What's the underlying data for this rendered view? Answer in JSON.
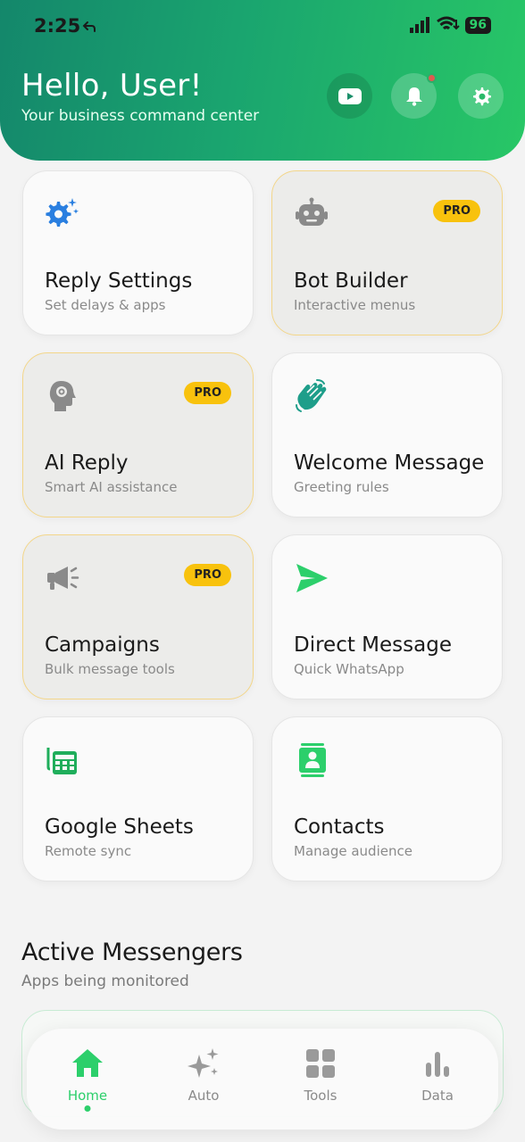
{
  "status": {
    "time": "2:25",
    "battery": "96"
  },
  "header": {
    "greeting": "Hello, User!",
    "subtitle": "Your business command center",
    "icons": [
      "youtube-icon",
      "bell-icon",
      "gear-icon"
    ]
  },
  "features": [
    {
      "title": "Reply Settings",
      "desc": "Set delays & apps",
      "pro": false,
      "icon": "gear-sparkle-icon"
    },
    {
      "title": "Bot Builder",
      "desc": "Interactive menus",
      "pro": true,
      "badge": "PRO",
      "icon": "robot-icon"
    },
    {
      "title": "AI Reply",
      "desc": "Smart AI assistance",
      "pro": true,
      "badge": "PRO",
      "icon": "brain-gear-icon"
    },
    {
      "title": "Welcome Message",
      "desc": "Greeting rules",
      "pro": false,
      "icon": "waving-hand-icon"
    },
    {
      "title": "Campaigns",
      "desc": "Bulk message tools",
      "pro": true,
      "badge": "PRO",
      "icon": "megaphone-icon"
    },
    {
      "title": "Direct Message",
      "desc": "Quick WhatsApp",
      "pro": false,
      "icon": "send-icon"
    },
    {
      "title": "Google Sheets",
      "desc": "Remote sync",
      "pro": false,
      "icon": "spreadsheet-icon"
    },
    {
      "title": "Contacts",
      "desc": "Manage audience",
      "pro": false,
      "icon": "contact-book-icon"
    }
  ],
  "active_messengers": {
    "title": "Active Messengers",
    "subtitle": "Apps being monitored"
  },
  "nav": [
    {
      "label": "Home",
      "icon": "home-icon",
      "active": true
    },
    {
      "label": "Auto",
      "icon": "sparkles-icon",
      "active": false
    },
    {
      "label": "Tools",
      "icon": "grid-icon",
      "active": false
    },
    {
      "label": "Data",
      "icon": "bar-chart-icon",
      "active": false
    }
  ],
  "colors": {
    "accent": "#2ccf6b",
    "pro_badge": "#f8c20d",
    "header_start": "#14876b",
    "header_end": "#28c766"
  }
}
